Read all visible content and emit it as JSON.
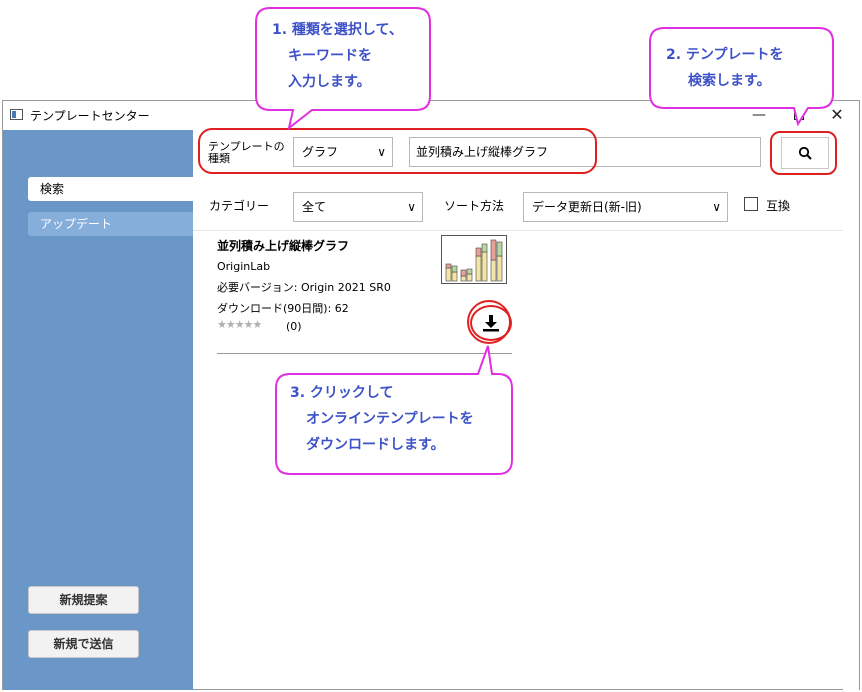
{
  "window": {
    "title": "テンプレートセンター"
  },
  "sidebar": {
    "items": [
      {
        "label": "検索"
      },
      {
        "label": "アップデート"
      }
    ],
    "buttons": {
      "propose": "新規提案",
      "send": "新規で送信"
    }
  },
  "search": {
    "type_label": "テンプレートの\n種類",
    "type_value": "グラフ",
    "keyword": "並列積み上げ縦棒グラフ"
  },
  "filters": {
    "category_label": "カテゴリー",
    "category_value": "全て",
    "sort_label": "ソート方法",
    "sort_value": "データ更新日(新-旧)",
    "compat_label": "互換"
  },
  "result": {
    "title": "並列積み上げ縦棒グラフ",
    "author": "OriginLab",
    "version": "必要バージョン: Origin 2021 SR0",
    "downloads": "ダウンロード(90日間): 62",
    "rating_count": "(0)",
    "stars": "★★★★★"
  },
  "callouts": {
    "c1": [
      "1. 種類を選択して、",
      "キーワードを",
      "入力します。"
    ],
    "c2": [
      "2. テンプレートを",
      "検索します。"
    ],
    "c3": [
      "3. クリックして",
      "オンラインテンプレートを",
      "ダウンロードします。"
    ]
  },
  "colors": {
    "sidebar": "#6a96c8",
    "highlight": "#e02020",
    "callout_border": "#e030e0",
    "callout_text": "#3d52c8"
  },
  "icons": [
    "app-icon",
    "search-icon",
    "download-icon",
    "chevron-down-icon",
    "close-icon",
    "maximize-icon",
    "minimize-icon"
  ]
}
